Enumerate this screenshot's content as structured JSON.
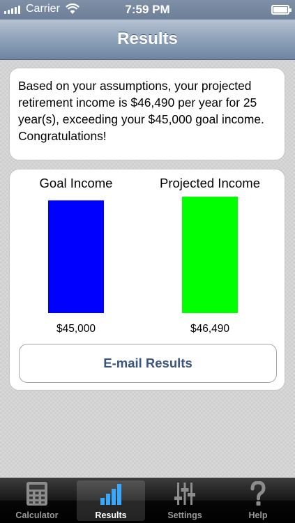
{
  "status_bar": {
    "carrier": "Carrier",
    "time": "7:59 PM"
  },
  "nav": {
    "title": "Results"
  },
  "message": {
    "text": "Based on your assumptions, your projected retirement income is $46,490 per year for 25 year(s), exceeding your $45,000 goal income. Congratulations!"
  },
  "chart_data": {
    "type": "bar",
    "categories": [
      "Goal Income",
      "Projected Income"
    ],
    "values": [
      45000,
      46490
    ],
    "value_labels": [
      "$45,000",
      "$46,490"
    ],
    "colors": [
      "#0000ff",
      "#00ff00"
    ],
    "title": "",
    "xlabel": "",
    "ylabel": "",
    "ylim": [
      0,
      46490
    ],
    "grid": false,
    "legend": "none"
  },
  "email_button": {
    "label": "E-mail Results"
  },
  "tabs": [
    {
      "label": "Calculator",
      "icon": "calculator-icon",
      "active": false
    },
    {
      "label": "Results",
      "icon": "bar-chart-icon",
      "active": true
    },
    {
      "label": "Settings",
      "icon": "sliders-icon",
      "active": false
    },
    {
      "label": "Help",
      "icon": "question-icon",
      "active": false
    }
  ]
}
